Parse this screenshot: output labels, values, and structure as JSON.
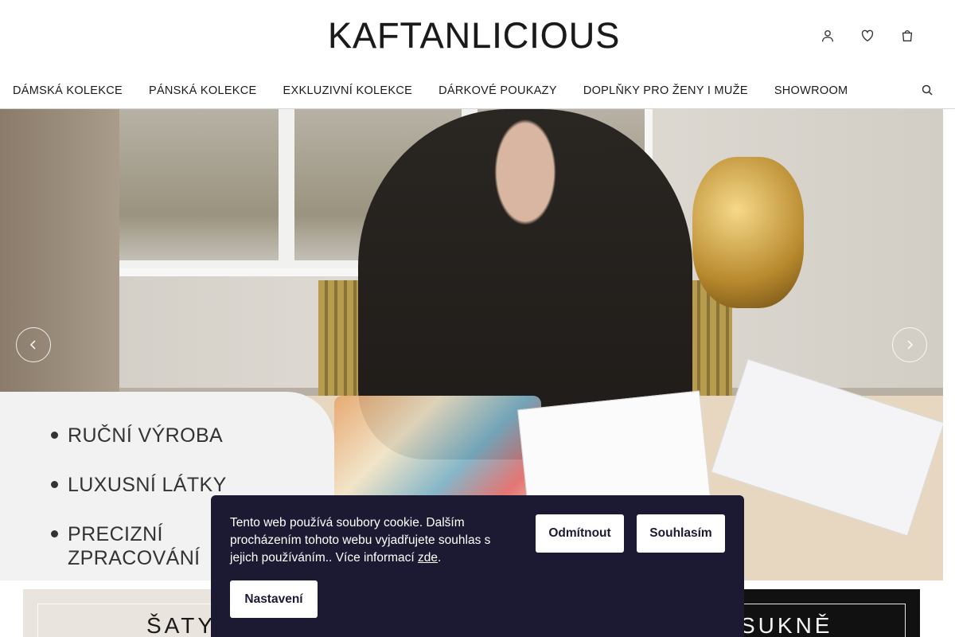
{
  "header": {
    "logo": "KAFTANLICIOUS",
    "icons": [
      "user-icon",
      "heart-icon",
      "cart-icon"
    ]
  },
  "nav": {
    "items": [
      {
        "label": "DÁMSKÁ KOLEKCE"
      },
      {
        "label": "PÁNSKÁ KOLEKCE"
      },
      {
        "label": "EXKLUZIVNÍ KOLEKCE"
      },
      {
        "label": "DÁRKOVÉ POUKAZY"
      },
      {
        "label": "DOPLŇKY PRO ŽENY I MUŽE"
      },
      {
        "label": "SHOWROOM"
      }
    ],
    "search_icon": "search-icon"
  },
  "hero": {
    "bullets": [
      "RUČNÍ VÝROBA",
      "LUXUSNÍ LÁTKY",
      "PRECIZNÍ",
      "ZPRACOVÁNÍ"
    ],
    "prev_icon": "chevron-left-icon",
    "next_icon": "chevron-right-icon"
  },
  "tiles": {
    "left_label": "ŠATY",
    "right_label": "SUKNĚ"
  },
  "cookie": {
    "text": "Tento web používá soubory cookie. Dalším procházením tohoto webu vyjadřujete souhlas s jejich používáním.. Více informací ",
    "link": "zde",
    "suffix": ".",
    "decline": "Odmítnout",
    "accept": "Souhlasím",
    "settings": "Nastavení",
    "bg_color": "#1c1a33"
  }
}
